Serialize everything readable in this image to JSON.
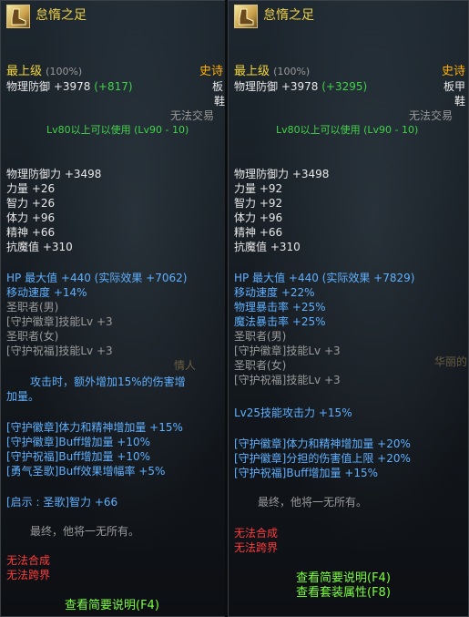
{
  "left": {
    "name": "怠惰之足",
    "grade": "最上级",
    "grade_pct": "(100%)",
    "rarity": "史诗",
    "type_line1": "板",
    "type_line2": "鞋",
    "defense_label": "物理防御 +3978",
    "defense_bonus": "(+817)",
    "trade": "无法交易",
    "level_req": "Lv80以上可以使用 (Lv90 - 10)",
    "bg_text_1": "情人",
    "stats": [
      "物理防御力 +3498",
      "力量 +26",
      "智力 +26",
      "体力 +96",
      "精神 +66",
      "抗魔值 +310"
    ],
    "hp": "HP 最大值 +440 (实际效果 +7062)",
    "move": "移动速度 +14%",
    "class_m": "圣职者(男)",
    "skill_1": "[守护徽章]技能Lv +3",
    "class_f": "圣职者(女)",
    "skill_2": "[守护祝福]技能Lv +3",
    "effect_1": "攻击时，额外增加15%的伤害增",
    "effect_2": "加量。",
    "buffs": [
      "[守护徽章]体力和精神增加量 +15%",
      "[守护徽章]Buff增加量 +10%",
      "[守护祝福]Buff增加量 +10%",
      "[勇气圣歌]Buff效果增幅率 +5%"
    ],
    "revelation": "[启示 : 圣歌]智力 +66",
    "flavor": "最终，他将一无所有。",
    "no_synth": "无法合成",
    "no_cross": "无法跨界",
    "link_1": "查看简要说明(F4)"
  },
  "right": {
    "name": "怠惰之足",
    "grade": "最上级",
    "grade_pct": "(100%)",
    "rarity": "史诗",
    "type_line1": "板甲",
    "type_line2": "鞋",
    "defense_label": "物理防御 +3978",
    "defense_bonus": "(+3295)",
    "trade": "无法交易",
    "level_req": "Lv80以上可以使用 (Lv90 - 10)",
    "bg_text_1": "华丽的",
    "stats": [
      "物理防御力 +3498",
      "力量 +92",
      "智力 +92",
      "体力 +96",
      "精神 +66",
      "抗魔值 +310"
    ],
    "hp": "HP 最大值 +440 (实际效果 +7829)",
    "blue_stats": [
      "移动速度 +22%",
      "物理暴击率 +25%",
      "魔法暴击率 +25%"
    ],
    "class_m": "圣职者(男)",
    "skill_1": "[守护徽章]技能Lv +3",
    "class_f": "圣职者(女)",
    "skill_2": "[守护祝福]技能Lv +3",
    "lv25": "Lv25技能攻击力 +15%",
    "buffs": [
      "[守护徽章]体力和精神增加量 +20%",
      "[守护徽章]分担的伤害值上限 +20%",
      "[守护祝福]Buff增加量 +15%"
    ],
    "flavor": "最终，他将一无所有。",
    "no_synth": "无法合成",
    "no_cross": "无法跨界",
    "link_1": "查看简要说明(F4)",
    "link_2": "查看套装属性(F8)"
  }
}
